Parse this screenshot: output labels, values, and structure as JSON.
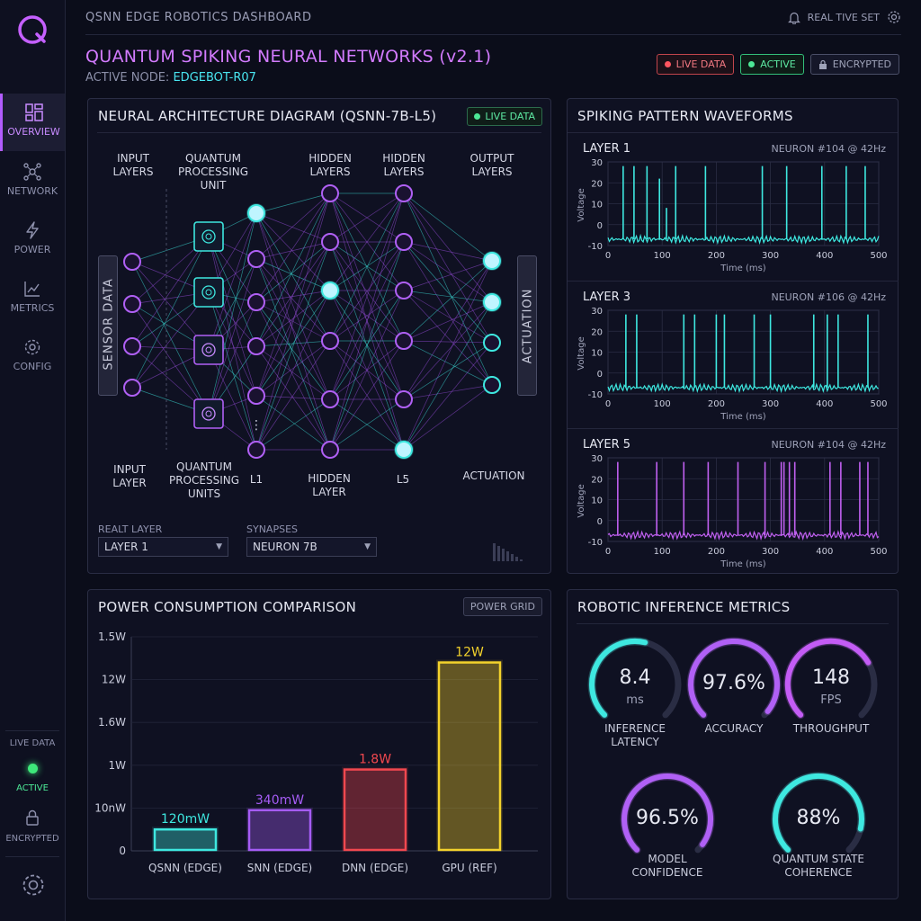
{
  "app": {
    "title": "QSNN EDGE ROBOTICS DASHBOARD",
    "realtime_label": "REAL TIVE SET",
    "page_title": "QUANTUM SPIKING NEURAL NETWORKS (v2.1)",
    "node_prefix": "ACTIVE NODE:",
    "node_name": "EDGEBOT-R07"
  },
  "badges": {
    "live": "LIVE DATA",
    "active": "ACTIVE",
    "encrypted": "ENCRYPTED"
  },
  "sidebar": {
    "items": [
      {
        "label": "OVERVIEW",
        "icon": "dashboard-icon"
      },
      {
        "label": "NETWORK",
        "icon": "network-icon"
      },
      {
        "label": "POWER",
        "icon": "bolt-icon"
      },
      {
        "label": "METRICS",
        "icon": "chart-icon"
      },
      {
        "label": "CONFIG",
        "icon": "gear-icon"
      }
    ],
    "status_live": "LIVE DATA",
    "status_active": "ACTIVE",
    "status_encrypted": "ENCRYPTED"
  },
  "architecture": {
    "title": "NEURAL ARCHITECTURE DIAGRAM (QSNN-7B-L5)",
    "chip": "LIVE DATA",
    "top_labels": [
      "INPUT\nLAYERS",
      "QUANTUM\nPROCESSING\nUNIT",
      "HIDDEN\nLAYERS",
      "HIDDEN\nLAYERS",
      "OUTPUT\nLAYERS"
    ],
    "bottom_labels": [
      "INPUT\nLAYER",
      "QUANTUM\nPROCESSING\nUNITS",
      "L1",
      "HIDDEN\nLAYER",
      "L5",
      "ACTUATION"
    ],
    "left_box": "SENSOR DATA",
    "right_box": "ACTUATION",
    "select1": {
      "label": "REALT LAYER",
      "value": "LAYER 1"
    },
    "select2": {
      "label": "SYNAPSES",
      "value": "NEURON 7B"
    }
  },
  "waveforms": {
    "title": "SPIKING PATTERN WAVEFORMS",
    "y_label": "Voltage",
    "x_label": "Time (ms)",
    "x_ticks": [
      "0",
      "100",
      "200",
      "300",
      "400",
      "500"
    ],
    "y_ticks": [
      "30",
      "20",
      "10",
      "0",
      "-10"
    ],
    "panels": [
      {
        "layer": "LAYER 1",
        "neuron": "NEURON #104 @ 42Hz",
        "color": "#3ee8e0",
        "spikes": [
          28,
          48,
          72,
          95,
          108,
          125,
          180,
          285,
          330,
          395,
          440,
          475
        ],
        "heights": [
          28,
          28,
          28,
          22,
          8,
          28,
          28,
          28,
          28,
          28,
          28,
          28
        ]
      },
      {
        "layer": "LAYER 3",
        "neuron": "NEURON #106 @ 42Hz",
        "color": "#3ee8e0",
        "spikes": [
          33,
          53,
          140,
          160,
          200,
          215,
          270,
          300,
          380,
          405,
          425,
          480
        ],
        "heights": [
          28,
          28,
          28,
          28,
          28,
          28,
          28,
          28,
          28,
          28,
          28,
          28
        ]
      },
      {
        "layer": "LAYER 5",
        "neuron": "NEURON #104 @ 42Hz",
        "color": "#c060f0",
        "spikes": [
          18,
          90,
          140,
          185,
          240,
          290,
          320,
          325,
          335,
          345,
          410,
          430,
          465,
          480
        ],
        "heights": [
          28,
          28,
          28,
          28,
          28,
          28,
          28,
          28,
          28,
          28,
          28,
          28,
          28,
          28
        ]
      }
    ]
  },
  "power": {
    "title": "POWER CONSUMPTION COMPARISON",
    "chip": "POWER GRID",
    "chart_data": {
      "type": "bar",
      "categories": [
        "QSNN (EDGE)",
        "SNN (EDGE)",
        "DNN (EDGE)",
        "GPU (REF)"
      ],
      "values_label": [
        "120mW",
        "340mW",
        "1.8W",
        "12W"
      ],
      "y_ticks": [
        "1.5W",
        "12W",
        "1.6W",
        "1W",
        "10nW",
        "0"
      ],
      "relative_heights": [
        0.1,
        0.19,
        0.38,
        0.88
      ],
      "colors": [
        "#3ee8e0",
        "#a55cf5",
        "#f2484f",
        "#f3d22c"
      ]
    }
  },
  "metrics": {
    "title": "ROBOTIC INFERENCE METRICS",
    "gauges": [
      {
        "value": "8.4",
        "unit": "ms",
        "label": "INFERENCE\nLATENCY",
        "fraction": 0.55,
        "color": "#3ee8e0"
      },
      {
        "value": "97.6%",
        "unit": "",
        "label": "ACCURACY",
        "fraction": 0.976,
        "color": "#b060f5"
      },
      {
        "value": "148",
        "unit": "FPS",
        "label": "THROUGHPUT",
        "fraction": 0.72,
        "color": "#c45cf5"
      },
      {
        "value": "96.5%",
        "unit": "",
        "label": "MODEL\nCONFIDENCE",
        "fraction": 0.965,
        "color": "#b060f5"
      },
      {
        "value": "88%",
        "unit": "",
        "label": "QUANTUM STATE\nCOHERENCE",
        "fraction": 0.88,
        "color": "#3ee8e0"
      }
    ]
  }
}
